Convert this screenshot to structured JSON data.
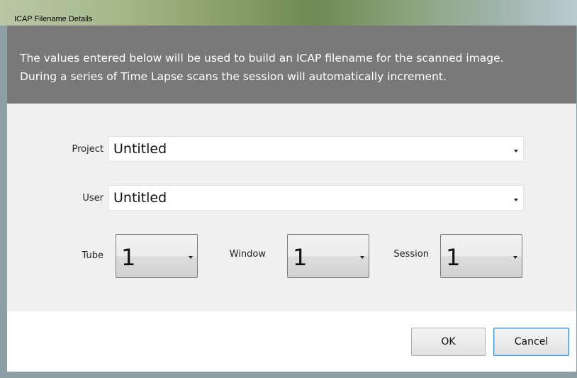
{
  "window": {
    "title": "ICAP Filename Details"
  },
  "banner": {
    "line1": "The values entered below will be used to build an  ICAP filename for the scanned image.",
    "line2": "During a series of Time Lapse scans the session will automatically increment."
  },
  "form": {
    "project": {
      "label": "Project",
      "value": "Untitled"
    },
    "user": {
      "label": "User",
      "value": "Untitled"
    },
    "tube": {
      "label": "Tube",
      "value": "1"
    },
    "window_field": {
      "label": "Window",
      "value": "1"
    },
    "session": {
      "label": "Session",
      "value": "1"
    }
  },
  "buttons": {
    "ok": "OK",
    "cancel": "Cancel"
  },
  "icons": {
    "dropdown": "chevron-down-icon"
  }
}
